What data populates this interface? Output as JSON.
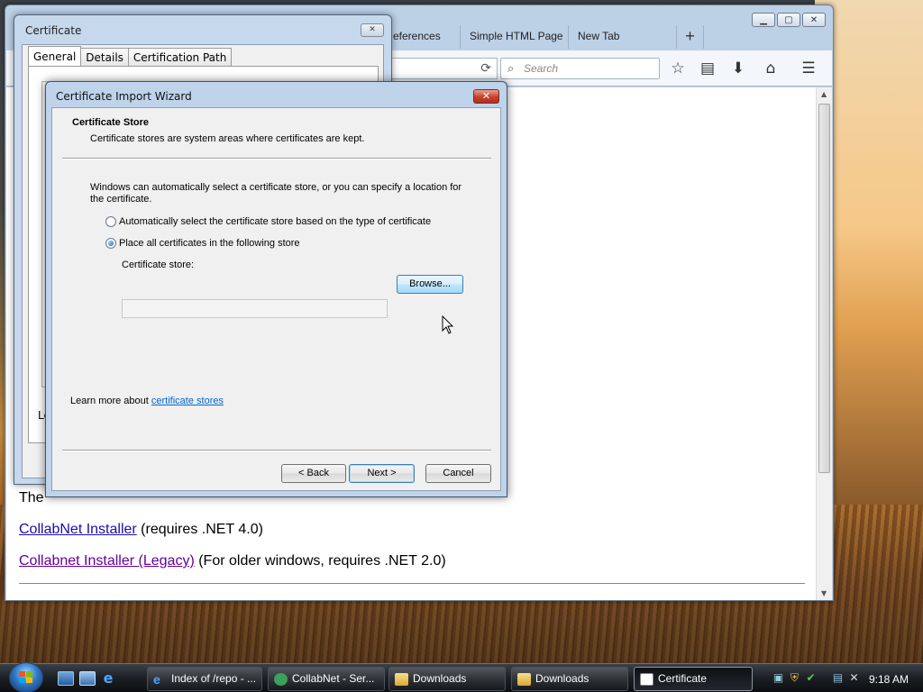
{
  "browser": {
    "tabs": [
      {
        "label": "eferences"
      },
      {
        "label": "Simple HTML Page"
      },
      {
        "label": "New Tab"
      }
    ],
    "new_tab_label": "+",
    "search_placeholder": "Search",
    "content": {
      "partial_line": "The",
      "links": [
        {
          "text": "CollabNet Installer",
          "suffix": " (requires .NET 4.0)"
        },
        {
          "text": "Collabnet Installer (Legacy)",
          "suffix": " (For older windows, requires .NET 2.0)"
        }
      ]
    }
  },
  "cert_window": {
    "title": "Certificate",
    "tabs": [
      "General",
      "Details",
      "Certification Path"
    ],
    "partial_text": "Le"
  },
  "wizard": {
    "title": "Certificate Import Wizard",
    "header_title": "Certificate Store",
    "header_subtitle": "Certificate stores are system areas where certificates are kept.",
    "description_line1": "Windows can automatically select a certificate store, or you can specify a location for",
    "description_line2": "the certificate.",
    "radio_auto_label": "Automatically select the certificate store based on the type of certificate",
    "radio_manual_label": "Place all certificates in the following store",
    "selected_option": "manual",
    "store_label": "Certificate store:",
    "store_value": "",
    "browse_label": "Browse...",
    "learn_prefix": "Learn more about ",
    "learn_link": "certificate stores",
    "back_label": "< Back",
    "next_label": "Next >",
    "cancel_label": "Cancel"
  },
  "taskbar": {
    "buttons": [
      {
        "label": "Index of /repo - ...",
        "icon": "ie-icon"
      },
      {
        "label": "CollabNet - Ser...",
        "icon": "collabnet-icon"
      },
      {
        "label": "Downloads",
        "icon": "folder-icon"
      },
      {
        "label": "Downloads",
        "icon": "folder-icon"
      },
      {
        "label": "Certificate",
        "icon": "certificate-icon",
        "active": true
      }
    ],
    "clock": "9:18 AM"
  },
  "colors": {
    "link": "#1a0dab",
    "visited_link": "#660099",
    "wizard_link": "#0066cc",
    "close_button_red": "#c8402c"
  }
}
